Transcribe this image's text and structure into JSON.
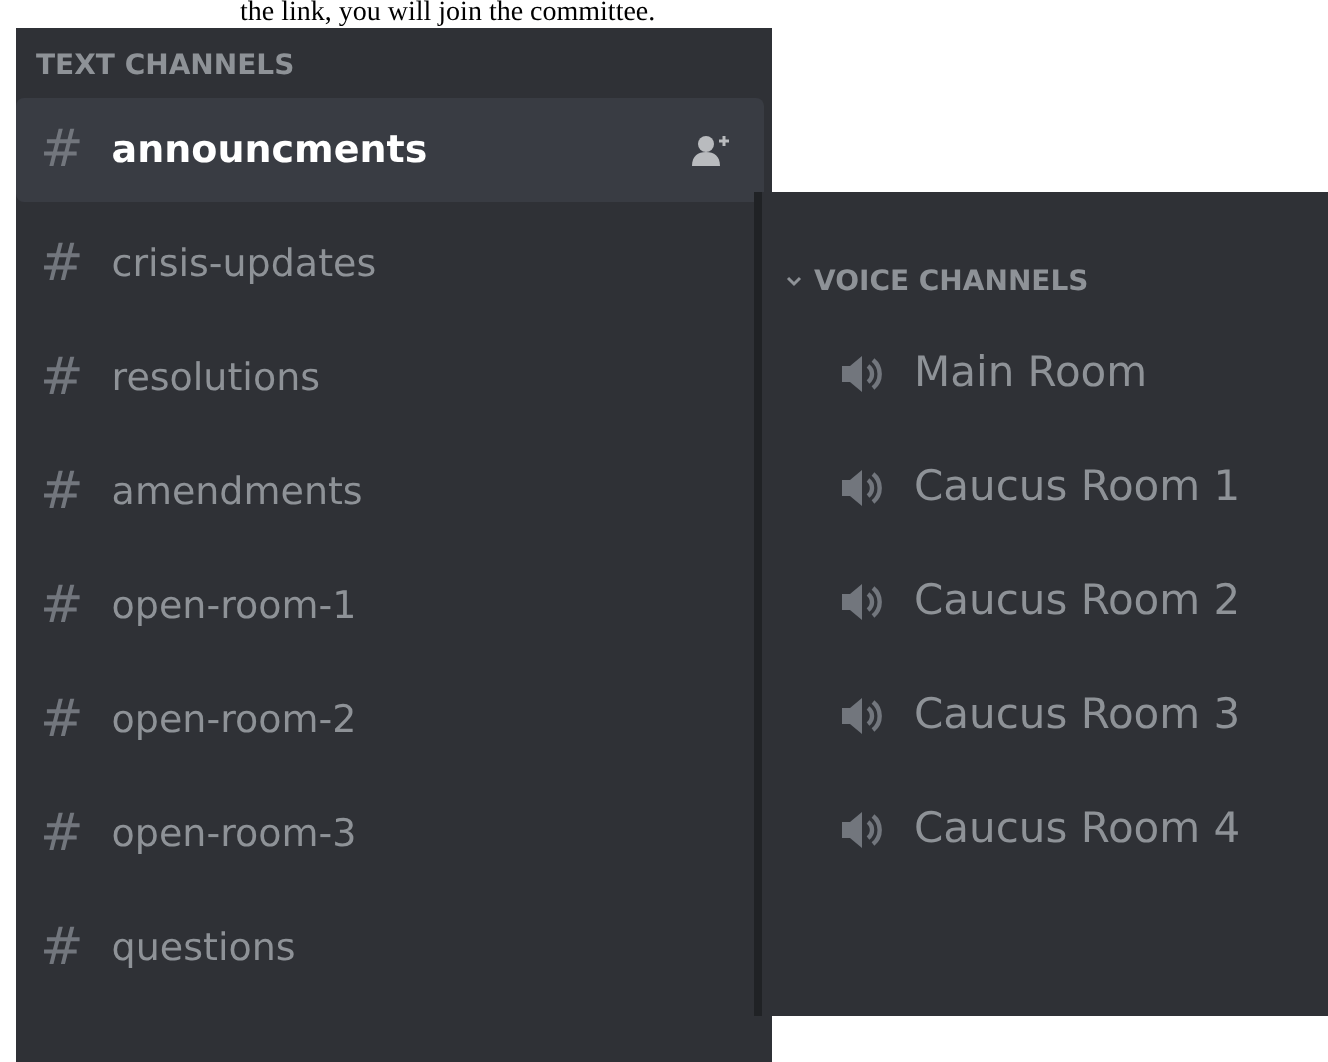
{
  "caption": "the link, you will join the committee.",
  "text_channels": {
    "header": "TEXT CHANNELS",
    "items": [
      {
        "icon": "#",
        "name": "announcments",
        "selected": true
      },
      {
        "icon": "#",
        "name": "crisis-updates",
        "selected": false
      },
      {
        "icon": "#",
        "name": "resolutions",
        "selected": false
      },
      {
        "icon": "#",
        "name": "amendments",
        "selected": false
      },
      {
        "icon": "#",
        "name": "open-room-1",
        "selected": false
      },
      {
        "icon": "#",
        "name": "open-room-2",
        "selected": false
      },
      {
        "icon": "#",
        "name": "open-room-3",
        "selected": false
      },
      {
        "icon": "#",
        "name": "questions",
        "selected": false
      }
    ]
  },
  "voice_channels": {
    "header": "VOICE CHANNELS",
    "items": [
      {
        "name": "Main Room"
      },
      {
        "name": "Caucus Room 1"
      },
      {
        "name": "Caucus Room 2"
      },
      {
        "name": "Caucus Room 3"
      },
      {
        "name": "Caucus Room 4"
      }
    ]
  }
}
